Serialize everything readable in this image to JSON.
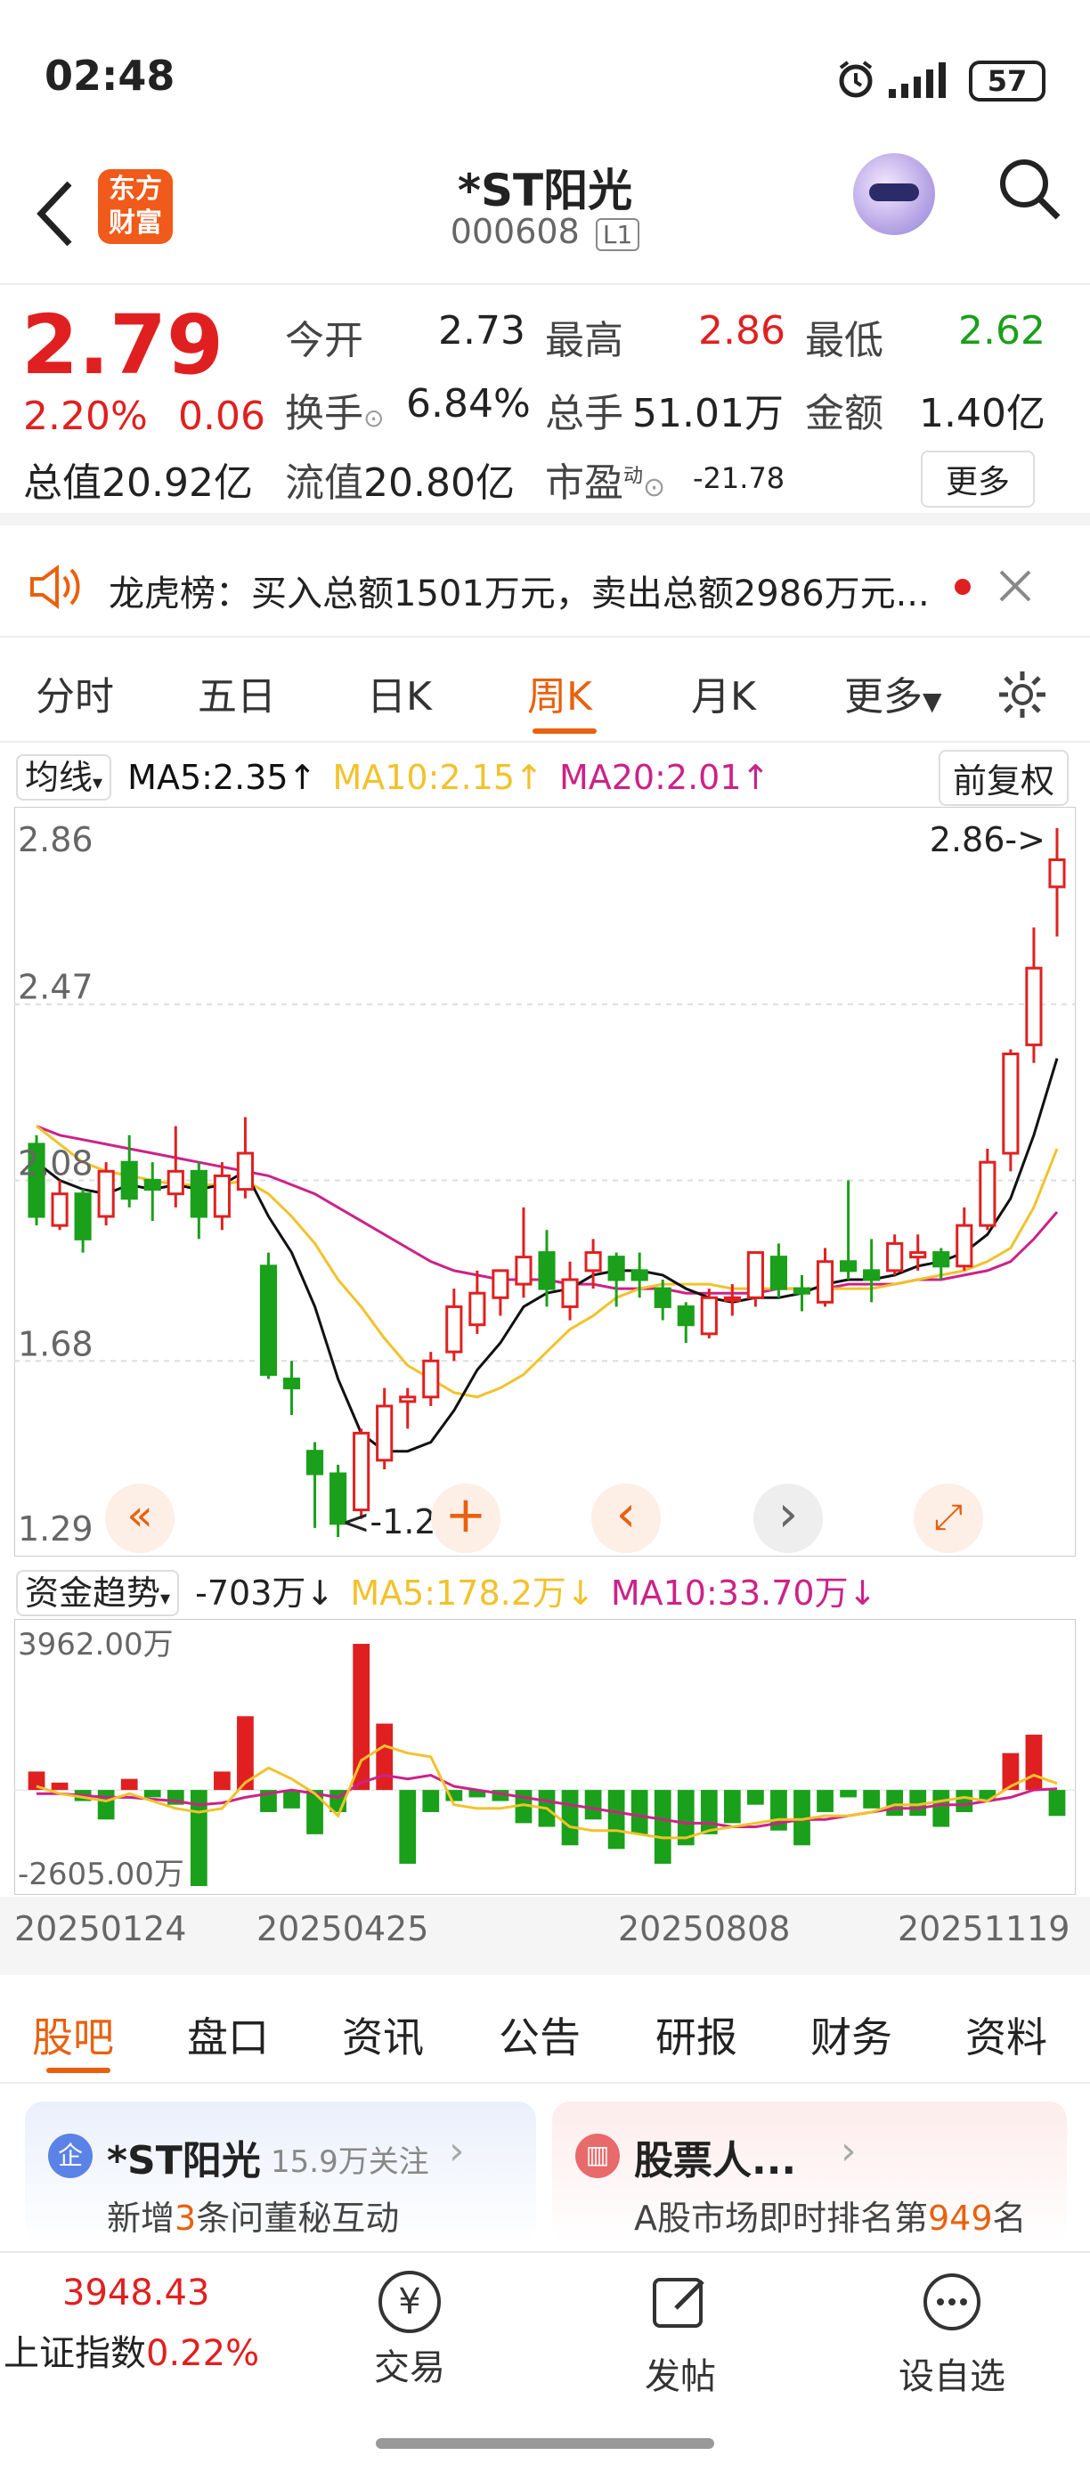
{
  "status": {
    "time": "02:48",
    "battery": "57"
  },
  "header": {
    "logo_line1": "东方",
    "logo_line2": "财富",
    "title": "*ST阳光",
    "code": "000608",
    "level": "L1"
  },
  "quote": {
    "price": "2.79",
    "pct": "2.20%",
    "change": "0.06",
    "open_label": "今开",
    "open": "2.73",
    "high_label": "最高",
    "high": "2.86",
    "low_label": "最低",
    "low": "2.62",
    "turnover_label": "换手",
    "turnover": "6.84%",
    "volume_label": "总手",
    "volume": "51.01万",
    "amount_label": "金额",
    "amount": "1.40亿",
    "cap_label": "总值",
    "cap": "20.92亿",
    "float_label": "流值",
    "float": "20.80亿",
    "pe_label": "市盈",
    "pe_sup": "动",
    "pe": "-21.78",
    "more": "更多"
  },
  "notice": {
    "text": "龙虎榜：买入总额1501万元，卖出总额2986万元..."
  },
  "chart_tabs": [
    "分时",
    "五日",
    "日K",
    "周K",
    "月K",
    "更多"
  ],
  "active_tab": "周K",
  "ma_bar": {
    "selector": "均线",
    "ma5": "MA5:2.35",
    "ma10": "MA10:2.15",
    "ma20": "MA20:2.01",
    "adjust": "前复权"
  },
  "kline": {
    "y_labels": [
      "2.86",
      "2.47",
      "2.08",
      "1.68",
      "1.29"
    ],
    "max_label": "2.86->",
    "min_label": "<-1.29"
  },
  "flow": {
    "selector": "资金趋势",
    "value": "-703万",
    "ma5": "MA5:178.2万",
    "ma10": "MA10:33.70万",
    "top": "3962.00万",
    "bottom": "-2605.00万"
  },
  "x_dates": [
    "20250124",
    "20250425",
    "20250808",
    "20251119"
  ],
  "chart_data": {
    "type": "candlestick",
    "candles": [
      [
        2.16,
        2.0,
        2.18,
        1.98
      ],
      [
        1.98,
        2.05,
        2.08,
        1.97
      ],
      [
        2.05,
        1.95,
        2.06,
        1.92
      ],
      [
        2.0,
        2.1,
        2.12,
        1.98
      ],
      [
        2.12,
        2.04,
        2.18,
        2.02
      ],
      [
        2.08,
        2.06,
        2.12,
        1.99
      ],
      [
        2.05,
        2.1,
        2.2,
        2.02
      ],
      [
        2.1,
        2.0,
        2.12,
        1.95
      ],
      [
        2.0,
        2.09,
        2.12,
        1.97
      ],
      [
        2.06,
        2.14,
        2.22,
        2.04
      ],
      [
        1.89,
        1.65,
        1.92,
        1.64
      ],
      [
        1.64,
        1.62,
        1.68,
        1.56
      ],
      [
        1.48,
        1.43,
        1.5,
        1.31
      ],
      [
        1.43,
        1.32,
        1.45,
        1.29
      ],
      [
        1.35,
        1.52,
        1.53,
        1.33
      ],
      [
        1.46,
        1.58,
        1.62,
        1.44
      ],
      [
        1.59,
        1.6,
        1.62,
        1.53
      ],
      [
        1.6,
        1.68,
        1.7,
        1.58
      ],
      [
        1.7,
        1.8,
        1.84,
        1.68
      ],
      [
        1.76,
        1.83,
        1.88,
        1.74
      ],
      [
        1.82,
        1.88,
        1.88,
        1.78
      ],
      [
        1.85,
        1.91,
        2.02,
        1.82
      ],
      [
        1.92,
        1.84,
        1.97,
        1.8
      ],
      [
        1.8,
        1.86,
        1.9,
        1.77
      ],
      [
        1.88,
        1.92,
        1.95,
        1.84
      ],
      [
        1.91,
        1.86,
        1.92,
        1.8
      ],
      [
        1.88,
        1.86,
        1.92,
        1.82
      ],
      [
        1.84,
        1.8,
        1.86,
        1.77
      ],
      [
        1.8,
        1.76,
        1.81,
        1.72
      ],
      [
        1.74,
        1.82,
        1.84,
        1.73
      ],
      [
        1.82,
        1.82,
        1.85,
        1.78
      ],
      [
        1.82,
        1.92,
        1.92,
        1.8
      ],
      [
        1.91,
        1.84,
        1.94,
        1.82
      ],
      [
        1.84,
        1.83,
        1.87,
        1.79
      ],
      [
        1.81,
        1.9,
        1.93,
        1.8
      ],
      [
        1.9,
        1.88,
        2.08,
        1.86
      ],
      [
        1.88,
        1.86,
        1.95,
        1.81
      ],
      [
        1.88,
        1.94,
        1.96,
        1.87
      ],
      [
        1.91,
        1.92,
        1.96,
        1.88
      ],
      [
        1.92,
        1.89,
        1.93,
        1.86
      ],
      [
        1.89,
        1.98,
        2.02,
        1.88
      ],
      [
        1.98,
        2.12,
        2.15,
        1.97
      ],
      [
        2.14,
        2.36,
        2.37,
        2.1
      ],
      [
        2.38,
        2.55,
        2.64,
        2.34
      ],
      [
        2.73,
        2.79,
        2.86,
        2.62
      ]
    ],
    "ma5": [
      2.12,
      2.08,
      2.06,
      2.05,
      2.07,
      2.06,
      2.07,
      2.06,
      2.07,
      2.1,
      2.0,
      1.92,
      1.8,
      1.64,
      1.52,
      1.48,
      1.48,
      1.5,
      1.57,
      1.66,
      1.72,
      1.8,
      1.83,
      1.84,
      1.87,
      1.88,
      1.88,
      1.87,
      1.84,
      1.82,
      1.81,
      1.82,
      1.82,
      1.83,
      1.85,
      1.86,
      1.86,
      1.87,
      1.89,
      1.9,
      1.92,
      1.96,
      2.04,
      2.18,
      2.35
    ],
    "ma10": [
      2.2,
      2.16,
      2.12,
      2.1,
      2.09,
      2.08,
      2.07,
      2.07,
      2.07,
      2.08,
      2.05,
      2.0,
      1.94,
      1.86,
      1.8,
      1.73,
      1.67,
      1.64,
      1.61,
      1.6,
      1.62,
      1.65,
      1.7,
      1.75,
      1.78,
      1.82,
      1.84,
      1.85,
      1.85,
      1.85,
      1.84,
      1.84,
      1.84,
      1.84,
      1.84,
      1.84,
      1.84,
      1.85,
      1.86,
      1.87,
      1.88,
      1.9,
      1.93,
      2.02,
      2.15
    ],
    "ma20": [
      2.2,
      2.18,
      2.17,
      2.16,
      2.15,
      2.14,
      2.13,
      2.12,
      2.11,
      2.1,
      2.09,
      2.07,
      2.05,
      2.02,
      1.99,
      1.96,
      1.93,
      1.9,
      1.88,
      1.87,
      1.86,
      1.86,
      1.86,
      1.85,
      1.85,
      1.84,
      1.84,
      1.84,
      1.83,
      1.83,
      1.83,
      1.83,
      1.84,
      1.84,
      1.84,
      1.85,
      1.85,
      1.85,
      1.86,
      1.86,
      1.87,
      1.88,
      1.9,
      1.95,
      2.01
    ],
    "flow": [
      500,
      200,
      -300,
      -800,
      300,
      -200,
      -400,
      -2605,
      500,
      2000,
      -600,
      -500,
      -1200,
      -600,
      3962,
      1800,
      -2000,
      -600,
      -300,
      -200,
      -300,
      -900,
      -1000,
      -1500,
      -800,
      -1600,
      -1200,
      -2000,
      -1500,
      -1200,
      -900,
      -400,
      -1100,
      -1500,
      -600,
      -200,
      -500,
      -700,
      -700,
      -1000,
      -600,
      -300,
      1000,
      1500,
      -703
    ],
    "flow_ma5": [
      100,
      -100,
      -200,
      -300,
      -100,
      -300,
      -500,
      -600,
      -500,
      200,
      600,
      300,
      -100,
      -700,
      800,
      1200,
      1000,
      900,
      -400,
      -500,
      -500,
      -400,
      -500,
      -1000,
      -1100,
      -1100,
      -1200,
      -1300,
      -1300,
      -1100,
      -1000,
      -900,
      -800,
      -800,
      -700,
      -700,
      -600,
      -400,
      -400,
      -300,
      -200,
      -300,
      100,
      400,
      178
    ],
    "flow_ma10": [
      -100,
      -100,
      -150,
      -200,
      -200,
      -250,
      -300,
      -400,
      -350,
      -200,
      -100,
      0,
      -100,
      -200,
      200,
      400,
      300,
      400,
      100,
      0,
      -100,
      -200,
      -300,
      -400,
      -500,
      -600,
      -700,
      -800,
      -900,
      -900,
      -1000,
      -1000,
      -900,
      -800,
      -800,
      -700,
      -600,
      -500,
      -500,
      -400,
      -400,
      -300,
      -200,
      0,
      34
    ]
  },
  "chart_buttons": [
    "«",
    "‹",
    "›"
  ],
  "bottom_tabs": [
    "股吧",
    "盘口",
    "资讯",
    "公告",
    "研报",
    "财务",
    "资料"
  ],
  "cards": {
    "left_badge": "企",
    "left_title": "*ST阳光",
    "left_sub": "15.9万关注",
    "left_line_pre": "新增",
    "left_line_num": "3",
    "left_line_post": "条问董秘互动",
    "right_title": "股票人...",
    "right_line_pre": "A股市场即时排名第",
    "right_line_num": "949",
    "right_line_post": "名"
  },
  "footer": {
    "index_value": "3948.43",
    "index_name": "上证指数",
    "index_pct": "0.22%",
    "trade": "交易",
    "post": "发帖",
    "watch": "设自选",
    "trade_icon_char": "¥"
  },
  "colors": {
    "up": "#e02020",
    "down": "#1aa01a",
    "accent": "#e8610f",
    "ma5": "#111111",
    "ma10": "#f2c22c",
    "ma20": "#cc2288"
  }
}
